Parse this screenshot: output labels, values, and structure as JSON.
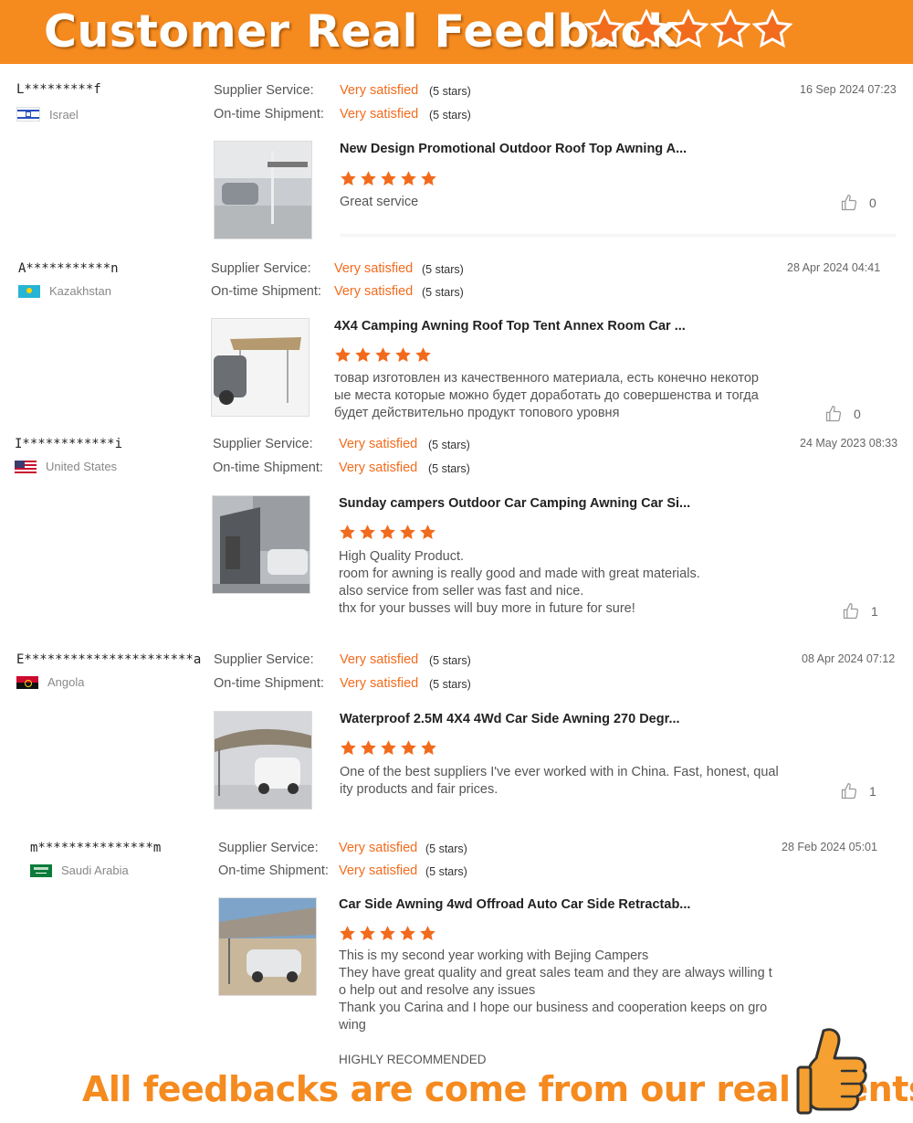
{
  "banner": {
    "title": "Customer Real Feedback"
  },
  "labels": {
    "supplier": "Supplier Service:",
    "shipment": "On-time Shipment:"
  },
  "colors": {
    "accent": "#f58a1f",
    "value_text": "#f26b1d"
  },
  "reviews": [
    {
      "user": "L*********f",
      "country": "Israel",
      "flag": "israel-flag",
      "supplier_value": "Very satisfied",
      "supplier_stars": "(5 stars)",
      "shipment_value": "Very satisfied",
      "shipment_stars": "(5 stars)",
      "date": "16 Sep 2024 07:23",
      "product": "New Design Promotional Outdoor Roof Top Awning A...",
      "rating": 5,
      "comment": [
        "Great service"
      ],
      "likes": "0"
    },
    {
      "user": "A***********n",
      "country": "Kazakhstan",
      "flag": "kazakhstan-flag",
      "supplier_value": "Very satisfied",
      "supplier_stars": "(5 stars)",
      "shipment_value": "Very satisfied",
      "shipment_stars": "(5 stars)",
      "date": "28 Apr 2024 04:41",
      "product": "4X4 Camping Awning Roof Top Tent Annex Room Car ...",
      "rating": 5,
      "comment": [
        "товар изготовлен из качественного материала, есть конечно некотор",
        "ые места которые можно будет доработать до совершенства и тогда",
        "будет действительно продукт топового уровня"
      ],
      "likes": "0"
    },
    {
      "user": "I************i",
      "country": "United States",
      "flag": "usa-flag",
      "supplier_value": "Very satisfied",
      "supplier_stars": "(5 stars)",
      "shipment_value": "Very satisfied",
      "shipment_stars": "(5 stars)",
      "date": "24 May 2023 08:33",
      "product": "Sunday campers Outdoor Car Camping Awning Car Si...",
      "rating": 5,
      "comment": [
        "High Quality Product.",
        "room for awning is really good and made with great materials.",
        "also service from seller was fast and nice.",
        "thx for your busses will buy more in future for sure!"
      ],
      "likes": "1"
    },
    {
      "user": "E**********************a",
      "country": "Angola",
      "flag": "angola-flag",
      "supplier_value": "Very satisfied",
      "supplier_stars": "(5 stars)",
      "shipment_value": "Very satisfied",
      "shipment_stars": "(5 stars)",
      "date": "08 Apr 2024 07:12",
      "product": "Waterproof 2.5M 4X4 4Wd Car Side Awning 270 Degr...",
      "rating": 5,
      "comment": [
        "One of the best suppliers I've ever worked with in China. Fast, honest, qual",
        "ity products and fair prices."
      ],
      "likes": "1"
    },
    {
      "user": "m***************m",
      "country": "Saudi Arabia",
      "flag": "saudi-arabia-flag",
      "supplier_value": "Very satisfied",
      "supplier_stars": "(5 stars)",
      "shipment_value": "Very satisfied",
      "shipment_stars": "(5 stars)",
      "date": "28 Feb 2024 05:01",
      "product": "Car Side Awning 4wd Offroad Auto Car Side Retractab...",
      "rating": 5,
      "comment": [
        "This is my second year working with Bejing Campers",
        "They have great quality and great sales team and they are always willing t",
        "o help out and resolve any issues",
        "Thank you Carina and I hope our business and cooperation keeps on gro",
        "wing",
        "",
        "HIGHLY RECOMMENDED"
      ],
      "likes": ""
    }
  ],
  "footer": {
    "text": "All feedbacks are come from our real clients!"
  }
}
